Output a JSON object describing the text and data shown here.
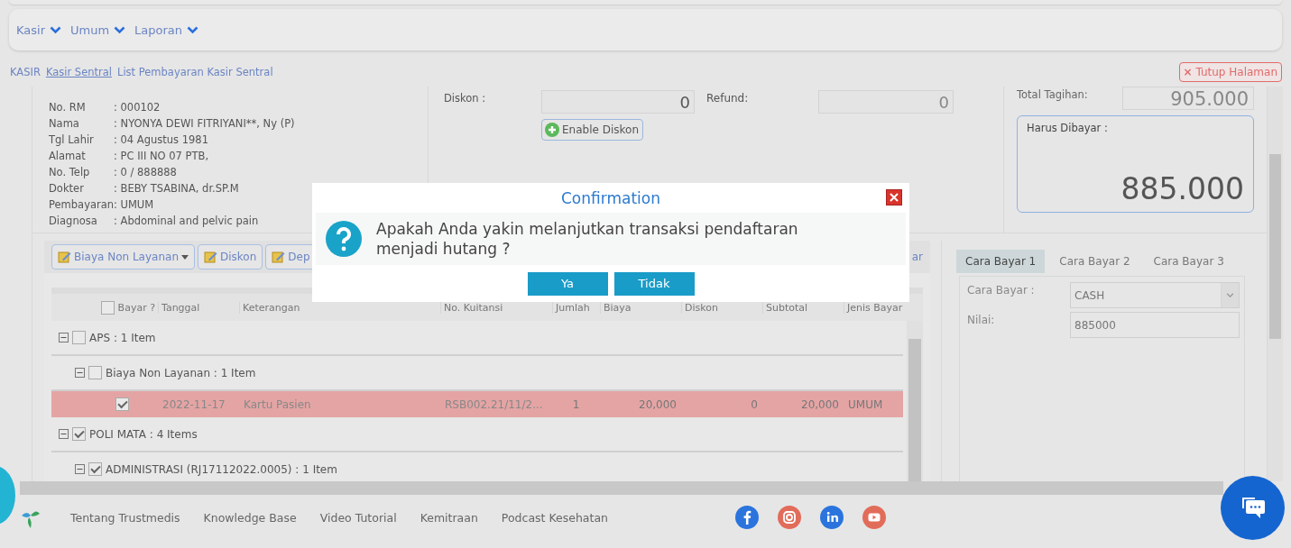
{
  "nav_menu": [
    {
      "label": "Kasir"
    },
    {
      "label": "Umum"
    },
    {
      "label": "Laporan"
    }
  ],
  "breadcrumb": [
    {
      "label": "KASIR",
      "selected": false
    },
    {
      "label": "Kasir Sentral",
      "selected": true
    },
    {
      "label": "List Pembayaran Kasir Sentral",
      "selected": false
    }
  ],
  "close_page_button": {
    "icon": "×",
    "label": "Tutup Halaman"
  },
  "patient_info": [
    {
      "label": "No. RM",
      "value": ": 000102"
    },
    {
      "label": "Nama",
      "value": ": NYONYA DEWI FITRIYANI**, Ny (P)"
    },
    {
      "label": "Tgl Lahir",
      "value": ": 04 Agustus 1981"
    },
    {
      "label": "Alamat",
      "value": ": PC III NO 07 PTB,"
    },
    {
      "label": "No. Telp",
      "value": ": 0 / 888888"
    },
    {
      "label": "Dokter",
      "value": ": BEBY TSABINA, dr.SP.M"
    },
    {
      "label": "Pembayaran",
      "value": ": UMUM"
    },
    {
      "label": "Diagnosa",
      "value": ": Abdominal and pelvic pain"
    }
  ],
  "discount": {
    "label": "Diskon :",
    "value": "0",
    "refund_label": "Refund:",
    "refund_value": "0",
    "enable_button": "Enable Diskon"
  },
  "totals": {
    "total_label": "Total Tagihan:",
    "total_value": "905.000",
    "due_label": "Harus Dibayar :",
    "due_value": "885.000"
  },
  "toolbar": [
    {
      "label": "Biaya Non Layanan",
      "kind": "dropdown"
    },
    {
      "label": "Diskon",
      "kind": "button"
    },
    {
      "label": "Dep",
      "kind": "button"
    }
  ],
  "toolbar_end": "ar",
  "table": {
    "columns": [
      "Bayar ?",
      "Tanggal",
      "Keterangan",
      "No. Kuitansi",
      "Jumlah",
      "Biaya",
      "Diskon",
      "Subtotal",
      "Jenis Bayar"
    ],
    "header_checked": false,
    "rows": [
      {
        "kind": "group",
        "label": "APS : 1 Item",
        "checked": false,
        "expanded": true,
        "children": [
          {
            "kind": "group",
            "label": "Biaya Non Layanan : 1 Item",
            "checked": false,
            "expanded": true,
            "children": [
              {
                "kind": "item",
                "checked": true,
                "selected": true,
                "cells": [
                  "2022-11-17",
                  "Kartu Pasien",
                  "RSB002.21/11/2...",
                  "1",
                  "20,000",
                  "0",
                  "20,000",
                  "UMUM"
                ]
              }
            ]
          }
        ]
      },
      {
        "kind": "group",
        "label": "POLI MATA : 4 Items",
        "checked": true,
        "expanded": true,
        "children": [
          {
            "kind": "group",
            "label": "ADMINISTRASI (RJ17112022.0005) : 1 Item",
            "checked": true,
            "expanded": true
          }
        ]
      }
    ]
  },
  "payment_tabs": [
    {
      "label": "Cara Bayar 1",
      "selected": true
    },
    {
      "label": "Cara Bayar 2",
      "selected": false
    },
    {
      "label": "Cara Bayar 3",
      "selected": false
    }
  ],
  "payment_form": {
    "method_label": "Cara Bayar :",
    "method_value": "CASH",
    "amount_label": "Nilai:",
    "amount_value": "885000"
  },
  "footer_links": [
    "Tentang Trustmedis",
    "Knowledge Base",
    "Video Tutorial",
    "Kemitraan",
    "Podcast Kesehatan"
  ],
  "dialog": {
    "title": "Confirmation",
    "message": "Apakah Anda yakin melanjutkan transaksi pendaftaran menjadi hutang ?",
    "buttons": [
      "Ya",
      "Tidak"
    ]
  }
}
